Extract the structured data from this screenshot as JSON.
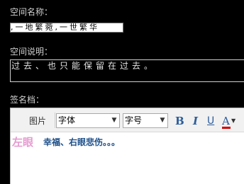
{
  "form": {
    "name_label": "空间名称：",
    "name_value": ",一地繁菀,一世繁华",
    "desc_label": "空间说明：",
    "desc_value": "过去、也只能保留在过去。",
    "signature_label": "签名档："
  },
  "editor": {
    "toolbar": {
      "image_label": "图片",
      "font_select_value": "字体",
      "size_select_value": "字号",
      "bold_label": "B",
      "italic_label": "I",
      "underline_label": "U",
      "font_color_label": "A"
    },
    "content": {
      "left_text": "左眼",
      "right_text": "幸福、右眼悲伤。。。",
      "left_color": "#e59ad0",
      "right_color": "#1c4f8a"
    }
  }
}
